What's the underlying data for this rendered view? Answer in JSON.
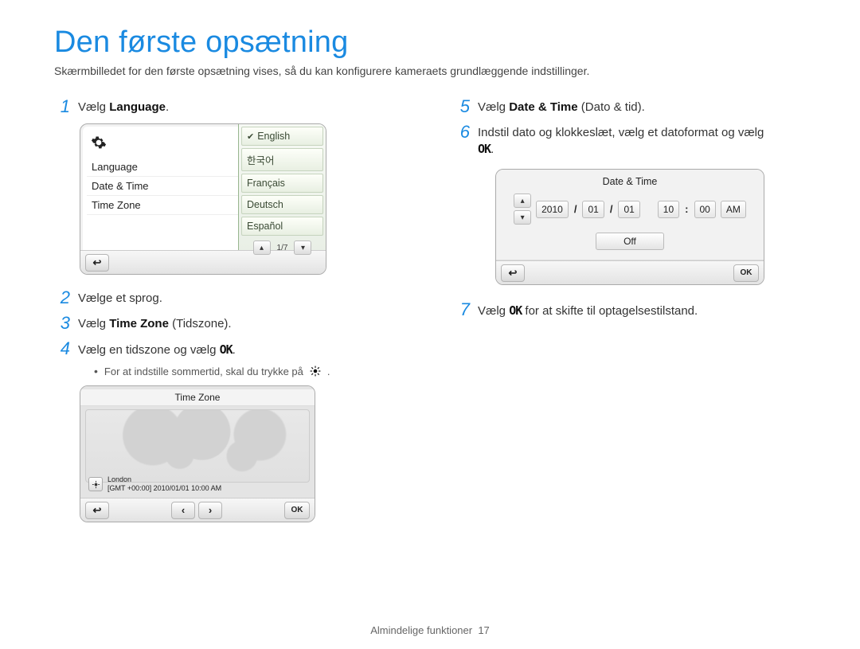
{
  "page": {
    "title": "Den første opsætning",
    "subtitle": "Skærmbilledet for den første opsætning vises, så du kan konfigurere kameraets grundlæggende indstillinger.",
    "footer_section": "Almindelige funktioner",
    "footer_page": "17"
  },
  "left_steps": {
    "s1_num": "1",
    "s1_pre": "Vælg ",
    "s1_bold": "Language",
    "s1_post": ".",
    "s2_num": "2",
    "s2_text": "Vælge et sprog.",
    "s3_num": "3",
    "s3_pre": "Vælg ",
    "s3_bold": "Time Zone",
    "s3_post": " (Tidszone).",
    "s4_num": "4",
    "s4_pre": "Vælg en tidszone og vælg ",
    "s4_ok": "OK",
    "s4_post": ".",
    "s4_bullet": "For at indstille sommertid, skal du trykke på"
  },
  "right_steps": {
    "s5_num": "5",
    "s5_pre": "Vælg ",
    "s5_bold": "Date & Time",
    "s5_post": " (Dato & tid).",
    "s6_num": "6",
    "s6_pre": "Indstil dato og klokkeslæt, vælg et datoformat og vælg ",
    "s6_ok": "OK",
    "s6_post": ".",
    "s7_num": "7",
    "s7_pre": "Vælg ",
    "s7_ok": "OK",
    "s7_post": " for at skifte til optagelsestilstand."
  },
  "lang_screen": {
    "left_items": [
      "Language",
      "Date & Time",
      "Time Zone"
    ],
    "options": [
      "English",
      "한국어",
      "Français",
      "Deutsch",
      "Español"
    ],
    "selected_index": 0,
    "pager": "1/7"
  },
  "tz_screen": {
    "title": "Time Zone",
    "city": "London",
    "line2": "[GMT +00:00] 2010/01/01 10:00 AM"
  },
  "dt_screen": {
    "title": "Date & Time",
    "year": "2010",
    "mon": "01",
    "day": "01",
    "hour": "10",
    "min": "00",
    "ampm": "AM",
    "off": "Off",
    "ok": "OK"
  }
}
